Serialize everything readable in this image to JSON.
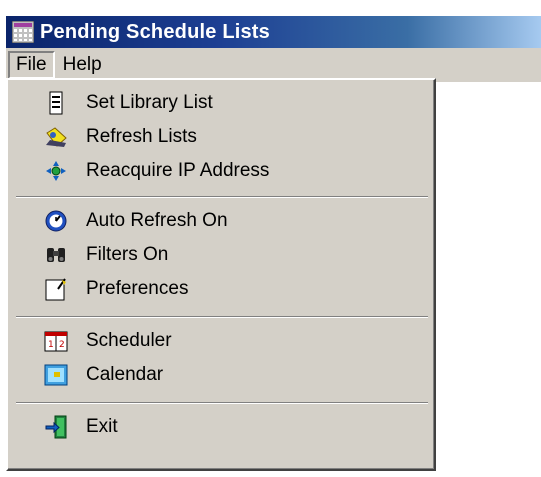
{
  "window": {
    "title": "Pending Schedule Lists"
  },
  "menubar": {
    "items": [
      {
        "label": "File",
        "active": true
      },
      {
        "label": "Help",
        "active": false
      }
    ]
  },
  "file_menu": {
    "groups": [
      [
        {
          "label": "Set Library List",
          "icon": "document-list-icon"
        },
        {
          "label": "Refresh Lists",
          "icon": "refresh-lists-icon"
        },
        {
          "label": "Reacquire IP Address",
          "icon": "network-icon"
        }
      ],
      [
        {
          "label": "Auto Refresh On",
          "icon": "clock-icon"
        },
        {
          "label": "Filters On",
          "icon": "binoculars-icon"
        },
        {
          "label": "Preferences",
          "icon": "preferences-icon"
        }
      ],
      [
        {
          "label": "Scheduler",
          "icon": "scheduler-icon"
        },
        {
          "label": "Calendar",
          "icon": "calendar-icon"
        }
      ],
      [
        {
          "label": "Exit",
          "icon": "exit-door-icon"
        }
      ]
    ]
  },
  "colors": {
    "titlebar_start": "#0a246a",
    "titlebar_end": "#a6caf0",
    "menu_face": "#d4d0c8"
  }
}
